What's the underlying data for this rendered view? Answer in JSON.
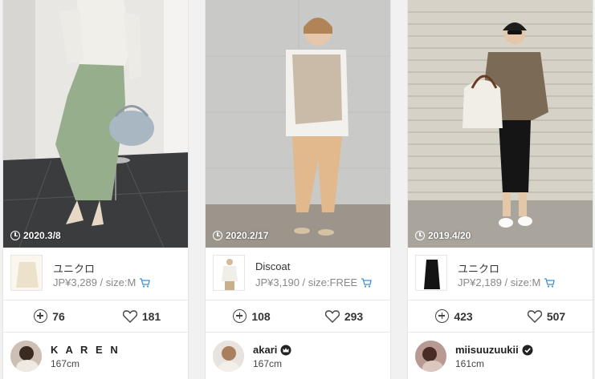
{
  "cards": [
    {
      "date": "2020.3/8",
      "item": {
        "brand": "ユニクロ",
        "price": "JP¥3,289 / size:M"
      },
      "clip_count": "76",
      "like_count": "181",
      "user": {
        "name": "K A R E N",
        "height": "167cm",
        "badge": ""
      }
    },
    {
      "date": "2020.2/17",
      "item": {
        "brand": "Discoat",
        "price": "JP¥3,190 / size:FREE"
      },
      "clip_count": "108",
      "like_count": "293",
      "user": {
        "name": "akari",
        "height": "167cm",
        "badge": "crown-badge-icon"
      }
    },
    {
      "date": "2019.4/20",
      "item": {
        "brand": "ユニクロ",
        "price": "JP¥2,189 / size:M"
      },
      "clip_count": "423",
      "like_count": "507",
      "user": {
        "name": "miisuuzuukii",
        "height": "161cm",
        "badge": "verified-badge-icon"
      }
    }
  ],
  "colors": {
    "cart_icon": "#3d8fd6",
    "border": "#e4e4e4",
    "background": "#f1f1f1"
  }
}
